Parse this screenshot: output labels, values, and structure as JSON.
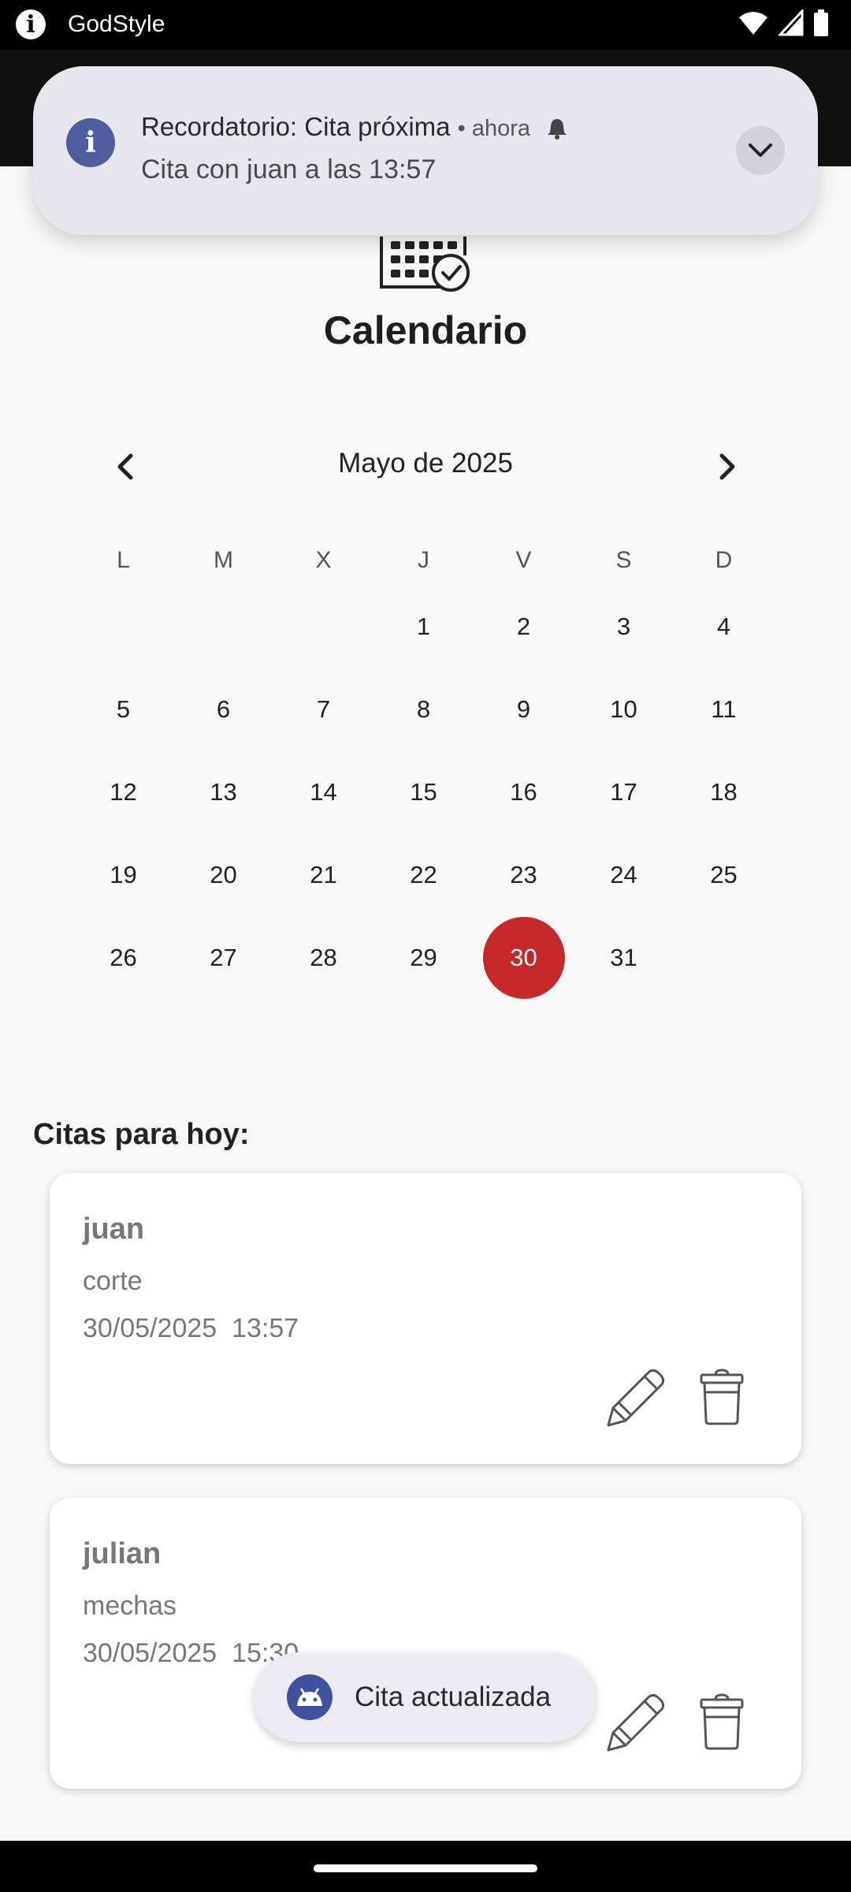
{
  "status_bar": {
    "app_name": "GodStyle"
  },
  "notification": {
    "title": "Recordatorio: Cita próxima",
    "time": "ahora",
    "body": "Cita con juan a las 13:57"
  },
  "header": {
    "title": "Calendario"
  },
  "calendar": {
    "month_label": "Mayo de 2025",
    "weekdays": [
      "L",
      "M",
      "X",
      "J",
      "V",
      "S",
      "D"
    ],
    "weeks": [
      [
        "",
        "",
        "",
        "1",
        "2",
        "3",
        "4"
      ],
      [
        "5",
        "6",
        "7",
        "8",
        "9",
        "10",
        "11"
      ],
      [
        "12",
        "13",
        "14",
        "15",
        "16",
        "17",
        "18"
      ],
      [
        "19",
        "20",
        "21",
        "22",
        "23",
        "24",
        "25"
      ],
      [
        "26",
        "27",
        "28",
        "29",
        "30",
        "31",
        ""
      ]
    ],
    "selected_day": "30",
    "selected_color": "#c62828"
  },
  "appointments": {
    "section_title": "Citas para hoy:",
    "items": [
      {
        "name": "juan",
        "service": "corte",
        "datetime": "30/05/2025  13:57"
      },
      {
        "name": "julian",
        "service": "mechas",
        "datetime": "30/05/2025  15:30"
      }
    ]
  },
  "toast": {
    "text": "Cita actualizada"
  }
}
